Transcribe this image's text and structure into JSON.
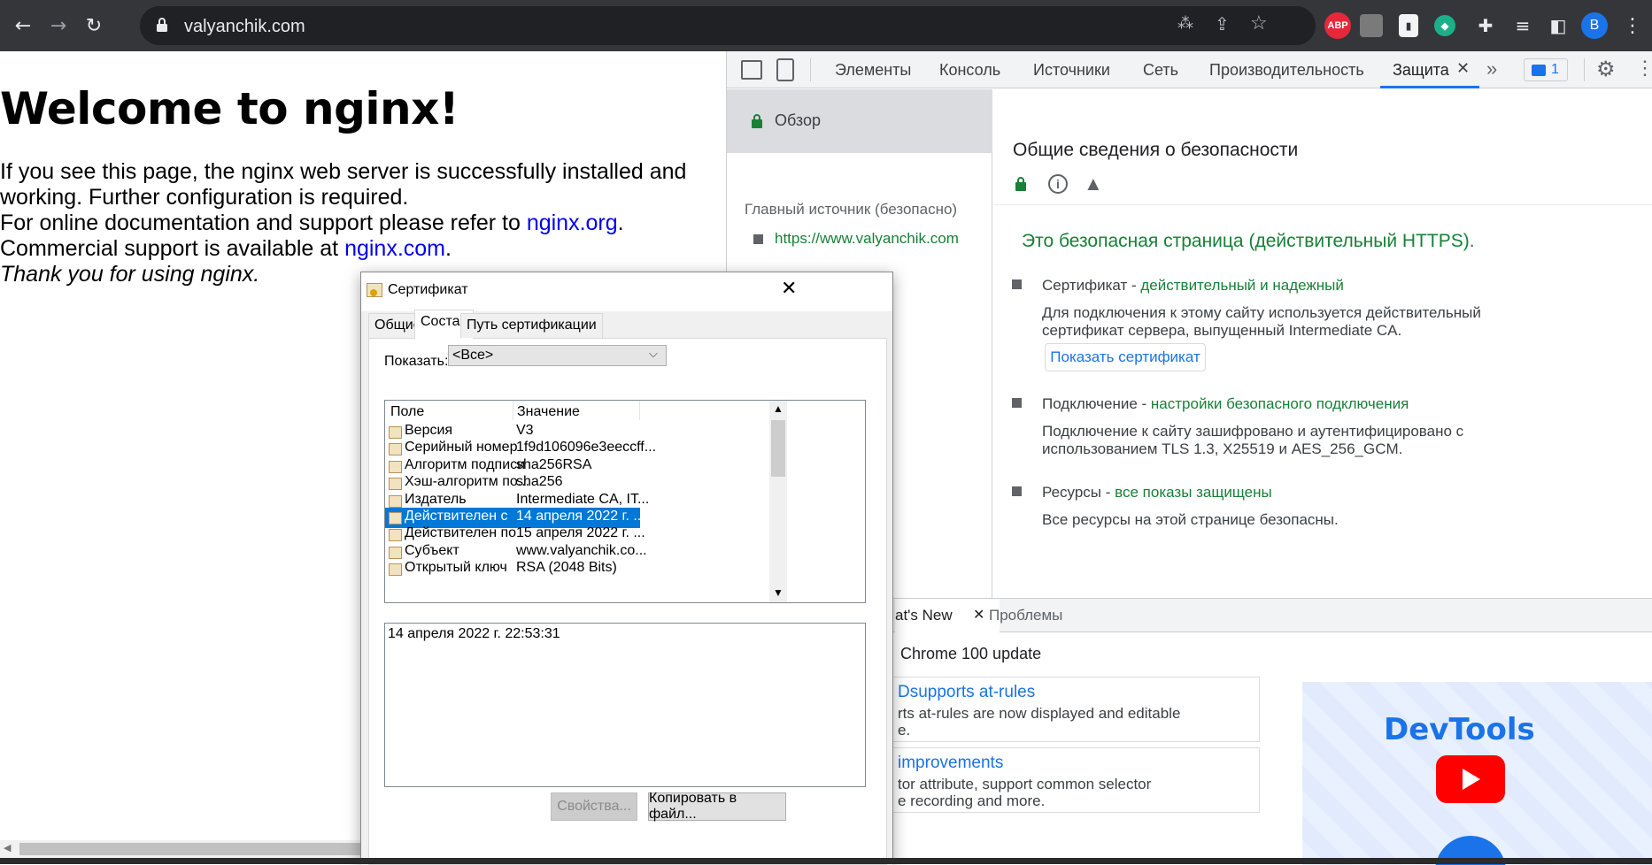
{
  "browser": {
    "url": "valyanchik.com",
    "profile_initial": "B",
    "extensions": [
      "ABP"
    ]
  },
  "page": {
    "heading": "Welcome to nginx!",
    "line1": "If you see this page, the nginx web server is successfully installed and",
    "line2": "working. Further configuration is required.",
    "line3_pre": "For online documentation and support please refer to ",
    "line3_link": "nginx.org",
    "line3_post": ".",
    "line4_pre": "Commercial support is available at ",
    "line4_link": "nginx.com",
    "line4_post": ".",
    "line5": "Thank you for using nginx."
  },
  "devtools": {
    "tabs": [
      "Элементы",
      "Консоль",
      "Источники",
      "Сеть",
      "Производительность",
      "Защита"
    ],
    "active_tab": "Защита",
    "issues_count": "1",
    "security": {
      "overview_label": "Обзор",
      "main_origin_label": "Главный источник (безопасно)",
      "origin_url": "https://www.valyanchik.com",
      "title": "Общие сведения о безопасности",
      "secure_message": "Это безопасная страница (действительный HTTPS).",
      "items": [
        {
          "name": "Сертификат",
          "status": "действительный и надежный",
          "desc1": "Для подключения к этому сайту используется действительный",
          "desc2": "сертификат сервера, выпущенный Intermediate CA."
        },
        {
          "name": "Подключение",
          "status": "настройки безопасного подключения",
          "desc1": "Подключение к сайту зашифровано и аутентифицировано с",
          "desc2": "использованием TLS 1.3, X25519 и AES_256_GCM."
        },
        {
          "name": "Ресурсы",
          "status": "все показы защищены",
          "desc1": "Все ресурсы на этой странице безопасны.",
          "desc2": ""
        }
      ],
      "show_cert_button": "Показать сертификат"
    },
    "drawer": {
      "tab_whatsnew": "at's New",
      "tab_issues": "Проблемы",
      "update_title": "Chrome 100 update",
      "card1_title": "Dsupports at-rules",
      "card1_text1": "rts at-rules are now displayed and editable",
      "card1_text2": "e.",
      "card2_title": "improvements",
      "card2_text1": "tor attribute, support common selector",
      "card2_text2": "e recording and more.",
      "promo_title": "DevTools"
    }
  },
  "certificate_dialog": {
    "title": "Сертификат",
    "tabs": [
      "Общие",
      "Состав",
      "Путь сертификации"
    ],
    "active_tab": "Состав",
    "show_label": "Показать:",
    "show_value": "<Все>",
    "columns": [
      "Поле",
      "Значение"
    ],
    "rows": [
      {
        "field": "Версия",
        "value": "V3"
      },
      {
        "field": "Серийный номер",
        "value": "1f9d106096e3eeccff..."
      },
      {
        "field": "Алгоритм подписи",
        "value": "sha256RSA"
      },
      {
        "field": "Хэш-алгоритм по...",
        "value": "sha256"
      },
      {
        "field": "Издатель",
        "value": "Intermediate CA, IT..."
      },
      {
        "field": "Действителен с",
        "value": "14 апреля 2022 г. ..."
      },
      {
        "field": "Действителен по",
        "value": "15 апреля 2022 г. ..."
      },
      {
        "field": "Субъект",
        "value": "www.valyanchik.co..."
      },
      {
        "field": "Открытый ключ",
        "value": "RSA (2048 Bits)"
      }
    ],
    "selected_row": "Действителен с",
    "detail_text": "14 апреля 2022 г. 22:53:31",
    "btn_properties": "Свойства...",
    "btn_copy": "Копировать в файл..."
  }
}
